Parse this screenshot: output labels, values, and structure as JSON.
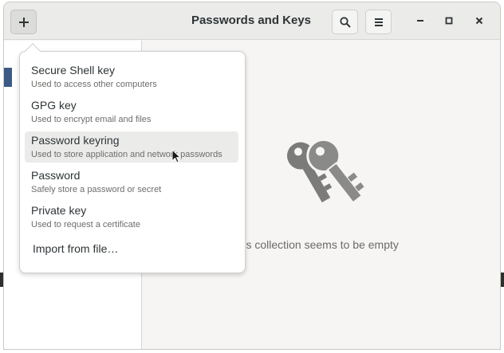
{
  "header": {
    "title": "Passwords and Keys",
    "add_icon": "plus-icon",
    "search_icon": "search-icon",
    "menu_icon": "hamburger-menu-icon",
    "minimize_icon": "minimize-icon",
    "maximize_icon": "maximize-icon",
    "close_icon": "close-icon"
  },
  "popover": {
    "items": [
      {
        "title": "Secure Shell key",
        "subtitle": "Used to access other computers"
      },
      {
        "title": "GPG key",
        "subtitle": "Used to encrypt email and files"
      },
      {
        "title": "Password keyring",
        "subtitle": "Used to store application and network passwords"
      },
      {
        "title": "Password",
        "subtitle": "Safely store a password or secret"
      },
      {
        "title": "Private key",
        "subtitle": "Used to request a certificate"
      }
    ],
    "import_label": "Import from file…",
    "hovered_index": 2
  },
  "content": {
    "empty_icon": "keys-icon",
    "empty_text": "This collection seems to be empty"
  },
  "colors": {
    "header_bg": "#ebebea",
    "sidebar_selection": "#3b5b85",
    "icon_gray": "#7b7b7a"
  }
}
